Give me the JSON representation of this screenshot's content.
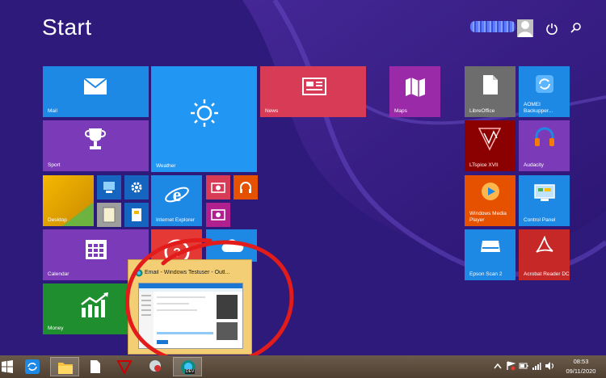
{
  "screen": {
    "title": "Start"
  },
  "tiles": {
    "mail": "Mail",
    "weather": "Weather",
    "news": "News",
    "maps": "Maps",
    "libreoffice": "LibreOffice",
    "aomei": "AOMEI Backupper...",
    "sport": "Sport",
    "ltspice": "LTspice XVII",
    "audacity": "Audacity",
    "desktop": "Desktop",
    "ie": "Internet Explorer",
    "wmp": "Windows Media Player",
    "control_panel": "Control Panel",
    "calendar": "Calendar",
    "epson": "Epson Scan 2",
    "acrobat": "Acrobat Reader DC",
    "money": "Money"
  },
  "taskbar_preview": {
    "title": "Email - Windows Testuser - Outl..."
  },
  "taskbar": {
    "edge_badge": "DEV",
    "time": "08:53",
    "date": "09/11/2020"
  },
  "colors": {
    "background": "#2d1a7a",
    "accent_blue": "#1e88e5",
    "accent_red": "#d83b56",
    "accent_purple": "#9b2aa8",
    "annotation_circle": "#e21b1b"
  }
}
